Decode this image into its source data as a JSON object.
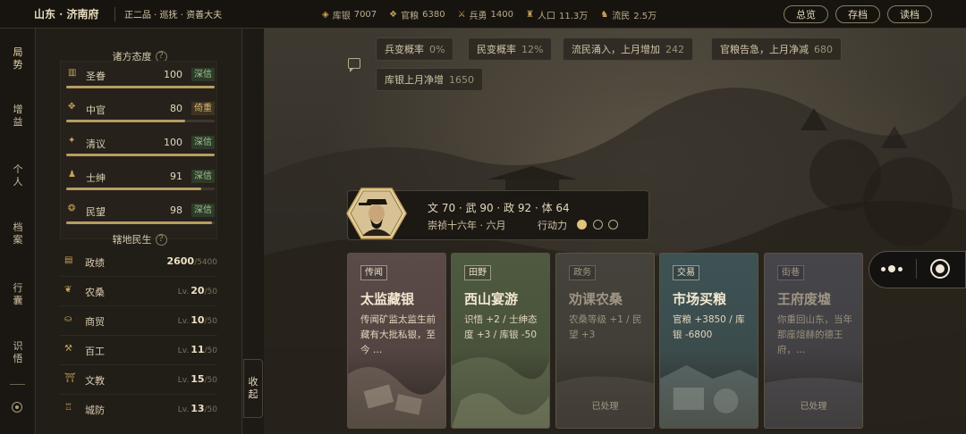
{
  "topbar": {
    "location": "山东 · 济南府",
    "rank": "正二品 · 巡抚 · 资善大夫",
    "resources": [
      {
        "icon": "silver-icon",
        "label": "库银",
        "value": "7007"
      },
      {
        "icon": "grain-icon",
        "label": "官粮",
        "value": "6380"
      },
      {
        "icon": "soldier-icon",
        "label": "兵勇",
        "value": "1400"
      },
      {
        "icon": "population-icon",
        "label": "人口",
        "value": "11.3万"
      },
      {
        "icon": "refugee-icon",
        "label": "流民",
        "value": "2.5万"
      }
    ],
    "buttons": {
      "overview": "总览",
      "save": "存档",
      "load": "读档"
    }
  },
  "nav": {
    "items": [
      "局势",
      "增益",
      "个人",
      "档案",
      "行囊",
      "识悟"
    ]
  },
  "attitudes": {
    "title": "诸方态度",
    "help": "?",
    "items": [
      {
        "name": "圣眷",
        "value": "100",
        "tag": "深信",
        "level": 1.0,
        "warn": false
      },
      {
        "name": "中官",
        "value": "80",
        "tag": "倚重",
        "level": 0.8,
        "warn": true
      },
      {
        "name": "清议",
        "value": "100",
        "tag": "深信",
        "level": 1.0,
        "warn": false
      },
      {
        "name": "士绅",
        "value": "91",
        "tag": "深信",
        "level": 0.91,
        "warn": false
      },
      {
        "name": "民望",
        "value": "98",
        "tag": "深信",
        "level": 0.98,
        "warn": false
      }
    ]
  },
  "province": {
    "title": "辖地民生",
    "help": "?",
    "items": [
      {
        "name": "政绩",
        "prefix": "",
        "value": "2600",
        "max": "/5400"
      },
      {
        "name": "农桑",
        "prefix": "Lv.",
        "value": "20",
        "max": "/50"
      },
      {
        "name": "商贸",
        "prefix": "Lv.",
        "value": "10",
        "max": "/50"
      },
      {
        "name": "百工",
        "prefix": "Lv.",
        "value": "11",
        "max": "/50"
      },
      {
        "name": "文教",
        "prefix": "Lv.",
        "value": "15",
        "max": "/50"
      },
      {
        "name": "城防",
        "prefix": "Lv.",
        "value": "13",
        "max": "/50"
      }
    ],
    "collapse_1": "收",
    "collapse_2": "起"
  },
  "status_chips": [
    {
      "label": "兵变概率",
      "value": "0%"
    },
    {
      "label": "民变概率",
      "value": "12%"
    },
    {
      "label": "流民涌入，上月增加",
      "value": "242"
    },
    {
      "label": "官粮告急，上月净减",
      "value": "680"
    },
    {
      "label": "库银上月净增",
      "value": "1650"
    }
  ],
  "character": {
    "stats": "文 70 · 武 90 · 政 92 · 体 64",
    "date": "崇祯十六年 · 六月",
    "action_label": "行动力",
    "action_points": 1,
    "action_max": 3
  },
  "cards": [
    {
      "tag": "传闻",
      "title": "太监藏银",
      "desc": "传闻矿监太监生前藏有大批私银，至今 …",
      "done": "",
      "color": "#5a4a48"
    },
    {
      "tag": "田野",
      "title": "西山宴游",
      "desc": "识悟 +2 / 士绅态度 +3 / 库银 -50",
      "done": "",
      "color": "#4e5a40"
    },
    {
      "tag": "政务",
      "title": "劝课农桑",
      "desc": "农桑等级 +1 / 民望 +3",
      "done": "已处理",
      "color": "#45423c"
    },
    {
      "tag": "交易",
      "title": "市场买粮",
      "desc": "官粮 +3850 / 库银 -6800",
      "done": "",
      "color": "#3e5254"
    },
    {
      "tag": "街巷",
      "title": "王府废墟",
      "desc": "你重回山东，当年那座煊赫的德王府，…",
      "done": "已处理",
      "color": "#46454a"
    }
  ]
}
